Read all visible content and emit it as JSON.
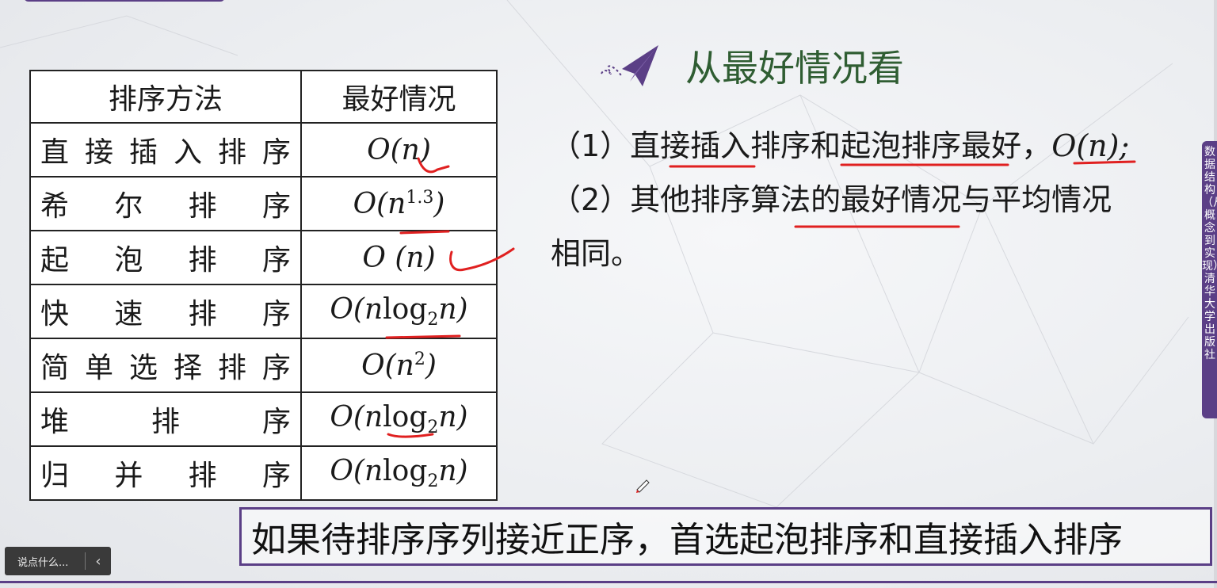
{
  "table": {
    "header": [
      "排序方法",
      "最好情况"
    ],
    "rows": [
      {
        "name_parts": [
          "直",
          "接",
          "插",
          "入",
          "排",
          "序"
        ],
        "complexity": "O(n)"
      },
      {
        "name_parts": [
          "希",
          "尔",
          "排",
          "序"
        ],
        "complexity": "O(n^1.3)"
      },
      {
        "name_parts": [
          "起",
          "泡",
          "排",
          "序"
        ],
        "complexity": "O (n)"
      },
      {
        "name_parts": [
          "快",
          "速",
          "排",
          "序"
        ],
        "complexity": "O(nlog2n)"
      },
      {
        "name_parts": [
          "简",
          "单",
          "选",
          "择",
          "排",
          "序"
        ],
        "complexity": "O(n^2)"
      },
      {
        "name_parts": [
          "堆",
          "排",
          "序"
        ],
        "complexity": "O(nlog2n)"
      },
      {
        "name_parts": [
          "归",
          "并",
          "排",
          "序"
        ],
        "complexity": "O(nlog2n)"
      }
    ]
  },
  "title": "从最好情况看",
  "points": {
    "p1_prefix": "（1）直接插入排序和起泡排序最好，",
    "p1_math": "O(n);",
    "p2_line1": "（2）其他排序算法的最好情况与平均情况",
    "p2_line2": "相同。"
  },
  "banner": "如果待排序序列接近正序，首选起泡排序和直接插入排序",
  "side_tab": "数据结构（从概念到实现）清华大学出版社",
  "chat": {
    "placeholder": "说点什么...",
    "collapse": "‹"
  },
  "colors": {
    "accent": "#5b3f86",
    "title": "#2f5d32",
    "ink": "#e02020"
  }
}
